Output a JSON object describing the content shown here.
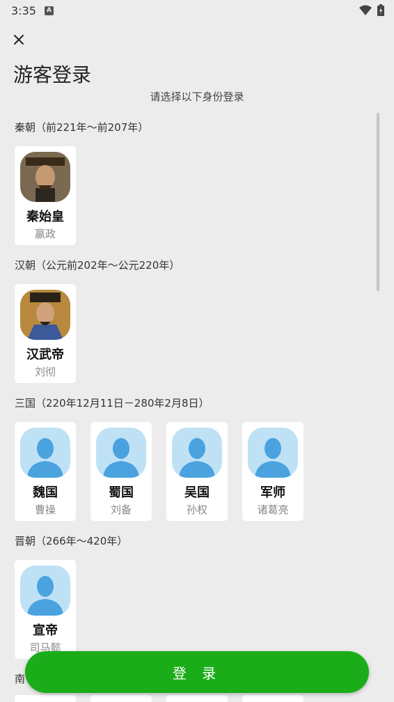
{
  "status_bar": {
    "time": "3:35",
    "notification_letter": "A"
  },
  "page": {
    "title": "游客登录",
    "subtitle": "请选择以下身份登录"
  },
  "sections": [
    {
      "title": "秦朝（前221年～前207年）",
      "cards": [
        {
          "name": "秦始皇",
          "sub": "嬴政",
          "avatar": "portrait-qin"
        }
      ]
    },
    {
      "title": "汉朝（公元前202年～公元220年）",
      "cards": [
        {
          "name": "汉武帝",
          "sub": "刘彻",
          "avatar": "portrait-han"
        }
      ]
    },
    {
      "title": "三国（220年12月11日－280年2月8日）",
      "cards": [
        {
          "name": "魏国",
          "sub": "曹操",
          "avatar": "default-avatar"
        },
        {
          "name": "蜀国",
          "sub": "刘备",
          "avatar": "default-avatar"
        },
        {
          "name": "吴国",
          "sub": "孙权",
          "avatar": "default-avatar"
        },
        {
          "name": "军师",
          "sub": "诸葛亮",
          "avatar": "default-avatar"
        }
      ]
    },
    {
      "title": "晋朝（266年～420年）",
      "cards": [
        {
          "name": "宣帝",
          "sub": "司马懿",
          "avatar": "default-avatar"
        }
      ]
    },
    {
      "title": "南",
      "cards": []
    }
  ],
  "login_button": {
    "label": "登 录"
  },
  "colors": {
    "accent": "#1aad19",
    "avatar_bg": "#bfe1f6",
    "avatar_figure": "#4aa3df"
  }
}
